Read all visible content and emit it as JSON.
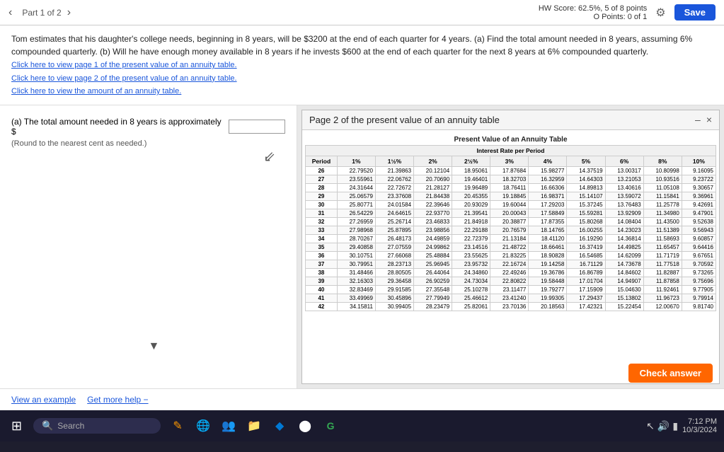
{
  "topbar": {
    "navigation": "Part 1 of 2",
    "hw_score_label": "HW Score: 62.5%, 5 of 8 points",
    "points_label": "O Points: 0 of 1",
    "save_label": "Save"
  },
  "question": {
    "text": "Tom estimates that his daughter's college needs, beginning in 8 years, will be $3200 at the end of each quarter for 4 years. (a) Find the total amount needed in 8 years, assuming 6% compounded quarterly. (b) Will he have enough money available in 8 years if he invests $600 at the end of each quarter for the next 8 years at 6% compounded quarterly.",
    "link1": "Click here to view page 1 of the present value of an annuity table.",
    "link2": "Click here to view page 2 of the present value of an annuity table.",
    "link3": "Click here to view the amount of an annuity table."
  },
  "part_a": {
    "label": "(a) The total amount needed in 8 years is approximately $",
    "note": "(Round to the nearest cent as needed.)"
  },
  "annuity_table": {
    "title": "Page 2 of the present value of an annuity table",
    "caption": "Present Value of an Annuity Table",
    "interest_header": "Interest Rate per Period",
    "columns": [
      "Period",
      "1%",
      "1½%",
      "2%",
      "2½%",
      "3%",
      "4%",
      "5%",
      "6%",
      "8%",
      "10%"
    ],
    "rows": [
      [
        "26",
        "22.79520",
        "21.39863",
        "20.12104",
        "18.95061",
        "17.87684",
        "15.98277",
        "14.37519",
        "13.00317",
        "10.80998",
        "9.16095"
      ],
      [
        "27",
        "23.55961",
        "22.06762",
        "20.70690",
        "19.46401",
        "18.32703",
        "16.32959",
        "14.64303",
        "13.21053",
        "10.93516",
        "9.23722"
      ],
      [
        "28",
        "24.31644",
        "22.72672",
        "21.28127",
        "19.96489",
        "18.76411",
        "16.66306",
        "14.89813",
        "13.40616",
        "11.05108",
        "9.30657"
      ],
      [
        "29",
        "25.06579",
        "23.37608",
        "21.84438",
        "20.45355",
        "19.18845",
        "16.98371",
        "15.14107",
        "13.59072",
        "11.15841",
        "9.36961"
      ],
      [
        "30",
        "25.80771",
        "24.01584",
        "22.39646",
        "20.93029",
        "19.60044",
        "17.29203",
        "15.37245",
        "13.76483",
        "11.25778",
        "9.42691"
      ],
      [
        "31",
        "26.54229",
        "24.64615",
        "22.93770",
        "21.39541",
        "20.00043",
        "17.58849",
        "15.59281",
        "13.92909",
        "11.34980",
        "9.47901"
      ],
      [
        "32",
        "27.26959",
        "25.26714",
        "23.46833",
        "21.84918",
        "20.38877",
        "17.87355",
        "15.80268",
        "14.08404",
        "11.43500",
        "9.52638"
      ],
      [
        "33",
        "27.98968",
        "25.87895",
        "23.98856",
        "22.29188",
        "20.76579",
        "18.14765",
        "16.00255",
        "14.23023",
        "11.51389",
        "9.56943"
      ],
      [
        "34",
        "28.70267",
        "26.48173",
        "24.49859",
        "22.72379",
        "21.13184",
        "18.41120",
        "16.19290",
        "14.36814",
        "11.58693",
        "9.60857"
      ],
      [
        "35",
        "29.40858",
        "27.07559",
        "24.99862",
        "23.14516",
        "21.48722",
        "18.66461",
        "16.37419",
        "14.49825",
        "11.65457",
        "9.64416"
      ],
      [
        "36",
        "30.10751",
        "27.66068",
        "25.48884",
        "23.55625",
        "21.83225",
        "18.90828",
        "16.54685",
        "14.62099",
        "11.71719",
        "9.67651"
      ],
      [
        "37",
        "30.79951",
        "28.23713",
        "25.96945",
        "23.95732",
        "22.16724",
        "19.14258",
        "16.71129",
        "14.73678",
        "11.77518",
        "9.70592"
      ],
      [
        "38",
        "31.48466",
        "28.80505",
        "26.44064",
        "24.34860",
        "22.49246",
        "19.36786",
        "16.86789",
        "14.84602",
        "11.82887",
        "9.73265"
      ],
      [
        "39",
        "32.16303",
        "29.36458",
        "26.90259",
        "24.73034",
        "22.80822",
        "19.58448",
        "17.01704",
        "14.94907",
        "11.87858",
        "9.75696"
      ],
      [
        "40",
        "32.83469",
        "29.91585",
        "27.35548",
        "25.10278",
        "23.11477",
        "19.79277",
        "17.15909",
        "15.04630",
        "11.92461",
        "9.77905"
      ],
      [
        "41",
        "33.49969",
        "30.45896",
        "27.79949",
        "25.46612",
        "23.41240",
        "19.99305",
        "17.29437",
        "15.13802",
        "11.96723",
        "9.79914"
      ],
      [
        "42",
        "34.15811",
        "30.99405",
        "28.23479",
        "25.82061",
        "23.70136",
        "20.18563",
        "17.42321",
        "15.22454",
        "12.00670",
        "9.81740"
      ]
    ]
  },
  "bottom_help": {
    "example_label": "an example",
    "help_label": "Get more help −"
  },
  "check_answer": {
    "label": "Check answer"
  },
  "taskbar": {
    "search_placeholder": "Search",
    "time": "7:12 PM",
    "date": "10/3/2024"
  }
}
